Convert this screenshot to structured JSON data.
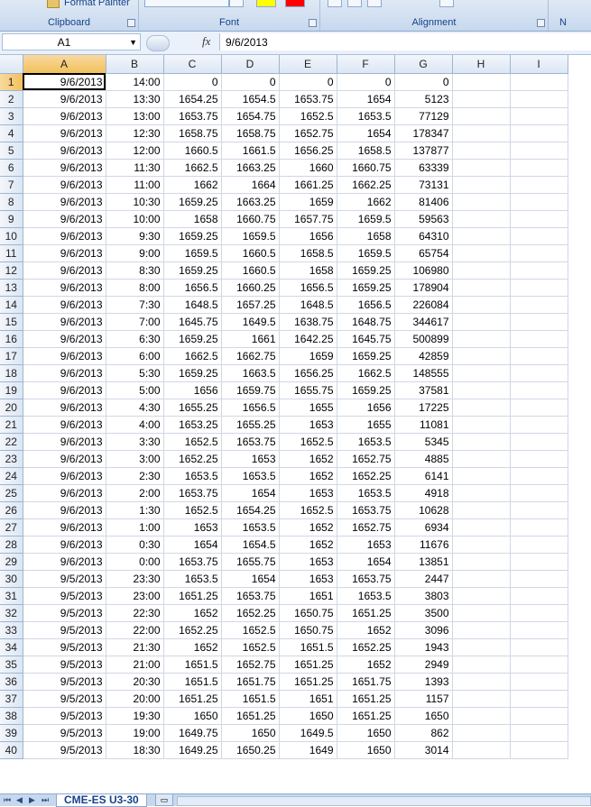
{
  "ribbon": {
    "format_painter_label": "Format Painter",
    "groups": [
      {
        "label": "Clipboard"
      },
      {
        "label": "Font"
      },
      {
        "label": "Alignment"
      },
      {
        "label": "N"
      }
    ],
    "colors": {
      "highlight": "#ffff00",
      "font_color": "#ff0000"
    }
  },
  "formula_bar": {
    "name_box": "A1",
    "fx_label": "fx",
    "formula": "9/6/2013"
  },
  "columns": [
    "A",
    "B",
    "C",
    "D",
    "E",
    "F",
    "G",
    "H",
    "I"
  ],
  "selected_cell": {
    "col": "A",
    "row": 1
  },
  "rows": [
    [
      "9/6/2013",
      "14:00",
      "0",
      "0",
      "0",
      "0",
      "0"
    ],
    [
      "9/6/2013",
      "13:30",
      "1654.25",
      "1654.5",
      "1653.75",
      "1654",
      "5123"
    ],
    [
      "9/6/2013",
      "13:00",
      "1653.75",
      "1654.75",
      "1652.5",
      "1653.5",
      "77129"
    ],
    [
      "9/6/2013",
      "12:30",
      "1658.75",
      "1658.75",
      "1652.75",
      "1654",
      "178347"
    ],
    [
      "9/6/2013",
      "12:00",
      "1660.5",
      "1661.5",
      "1656.25",
      "1658.5",
      "137877"
    ],
    [
      "9/6/2013",
      "11:30",
      "1662.5",
      "1663.25",
      "1660",
      "1660.75",
      "63339"
    ],
    [
      "9/6/2013",
      "11:00",
      "1662",
      "1664",
      "1661.25",
      "1662.25",
      "73131"
    ],
    [
      "9/6/2013",
      "10:30",
      "1659.25",
      "1663.25",
      "1659",
      "1662",
      "81406"
    ],
    [
      "9/6/2013",
      "10:00",
      "1658",
      "1660.75",
      "1657.75",
      "1659.5",
      "59563"
    ],
    [
      "9/6/2013",
      "9:30",
      "1659.25",
      "1659.5",
      "1656",
      "1658",
      "64310"
    ],
    [
      "9/6/2013",
      "9:00",
      "1659.5",
      "1660.5",
      "1658.5",
      "1659.5",
      "65754"
    ],
    [
      "9/6/2013",
      "8:30",
      "1659.25",
      "1660.5",
      "1658",
      "1659.25",
      "106980"
    ],
    [
      "9/6/2013",
      "8:00",
      "1656.5",
      "1660.25",
      "1656.5",
      "1659.25",
      "178904"
    ],
    [
      "9/6/2013",
      "7:30",
      "1648.5",
      "1657.25",
      "1648.5",
      "1656.5",
      "226084"
    ],
    [
      "9/6/2013",
      "7:00",
      "1645.75",
      "1649.5",
      "1638.75",
      "1648.75",
      "344617"
    ],
    [
      "9/6/2013",
      "6:30",
      "1659.25",
      "1661",
      "1642.25",
      "1645.75",
      "500899"
    ],
    [
      "9/6/2013",
      "6:00",
      "1662.5",
      "1662.75",
      "1659",
      "1659.25",
      "42859"
    ],
    [
      "9/6/2013",
      "5:30",
      "1659.25",
      "1663.5",
      "1656.25",
      "1662.5",
      "148555"
    ],
    [
      "9/6/2013",
      "5:00",
      "1656",
      "1659.75",
      "1655.75",
      "1659.25",
      "37581"
    ],
    [
      "9/6/2013",
      "4:30",
      "1655.25",
      "1656.5",
      "1655",
      "1656",
      "17225"
    ],
    [
      "9/6/2013",
      "4:00",
      "1653.25",
      "1655.25",
      "1653",
      "1655",
      "11081"
    ],
    [
      "9/6/2013",
      "3:30",
      "1652.5",
      "1653.75",
      "1652.5",
      "1653.5",
      "5345"
    ],
    [
      "9/6/2013",
      "3:00",
      "1652.25",
      "1653",
      "1652",
      "1652.75",
      "4885"
    ],
    [
      "9/6/2013",
      "2:30",
      "1653.5",
      "1653.5",
      "1652",
      "1652.25",
      "6141"
    ],
    [
      "9/6/2013",
      "2:00",
      "1653.75",
      "1654",
      "1653",
      "1653.5",
      "4918"
    ],
    [
      "9/6/2013",
      "1:30",
      "1652.5",
      "1654.25",
      "1652.5",
      "1653.75",
      "10628"
    ],
    [
      "9/6/2013",
      "1:00",
      "1653",
      "1653.5",
      "1652",
      "1652.75",
      "6934"
    ],
    [
      "9/6/2013",
      "0:30",
      "1654",
      "1654.5",
      "1652",
      "1653",
      "11676"
    ],
    [
      "9/6/2013",
      "0:00",
      "1653.75",
      "1655.75",
      "1653",
      "1654",
      "13851"
    ],
    [
      "9/5/2013",
      "23:30",
      "1653.5",
      "1654",
      "1653",
      "1653.75",
      "2447"
    ],
    [
      "9/5/2013",
      "23:00",
      "1651.25",
      "1653.75",
      "1651",
      "1653.5",
      "3803"
    ],
    [
      "9/5/2013",
      "22:30",
      "1652",
      "1652.25",
      "1650.75",
      "1651.25",
      "3500"
    ],
    [
      "9/5/2013",
      "22:00",
      "1652.25",
      "1652.5",
      "1650.75",
      "1652",
      "3096"
    ],
    [
      "9/5/2013",
      "21:30",
      "1652",
      "1652.5",
      "1651.5",
      "1652.25",
      "1943"
    ],
    [
      "9/5/2013",
      "21:00",
      "1651.5",
      "1652.75",
      "1651.25",
      "1652",
      "2949"
    ],
    [
      "9/5/2013",
      "20:30",
      "1651.5",
      "1651.75",
      "1651.25",
      "1651.75",
      "1393"
    ],
    [
      "9/5/2013",
      "20:00",
      "1651.25",
      "1651.5",
      "1651",
      "1651.25",
      "1157"
    ],
    [
      "9/5/2013",
      "19:30",
      "1650",
      "1651.25",
      "1650",
      "1651.25",
      "1650"
    ],
    [
      "9/5/2013",
      "19:00",
      "1649.75",
      "1650",
      "1649.5",
      "1650",
      "862"
    ],
    [
      "9/5/2013",
      "18:30",
      "1649.25",
      "1650.25",
      "1649",
      "1650",
      "3014"
    ]
  ],
  "sheet_tabs": {
    "active": "CME-ES U3-30",
    "nav": [
      "⏮",
      "◀",
      "▶",
      "⏭"
    ]
  }
}
